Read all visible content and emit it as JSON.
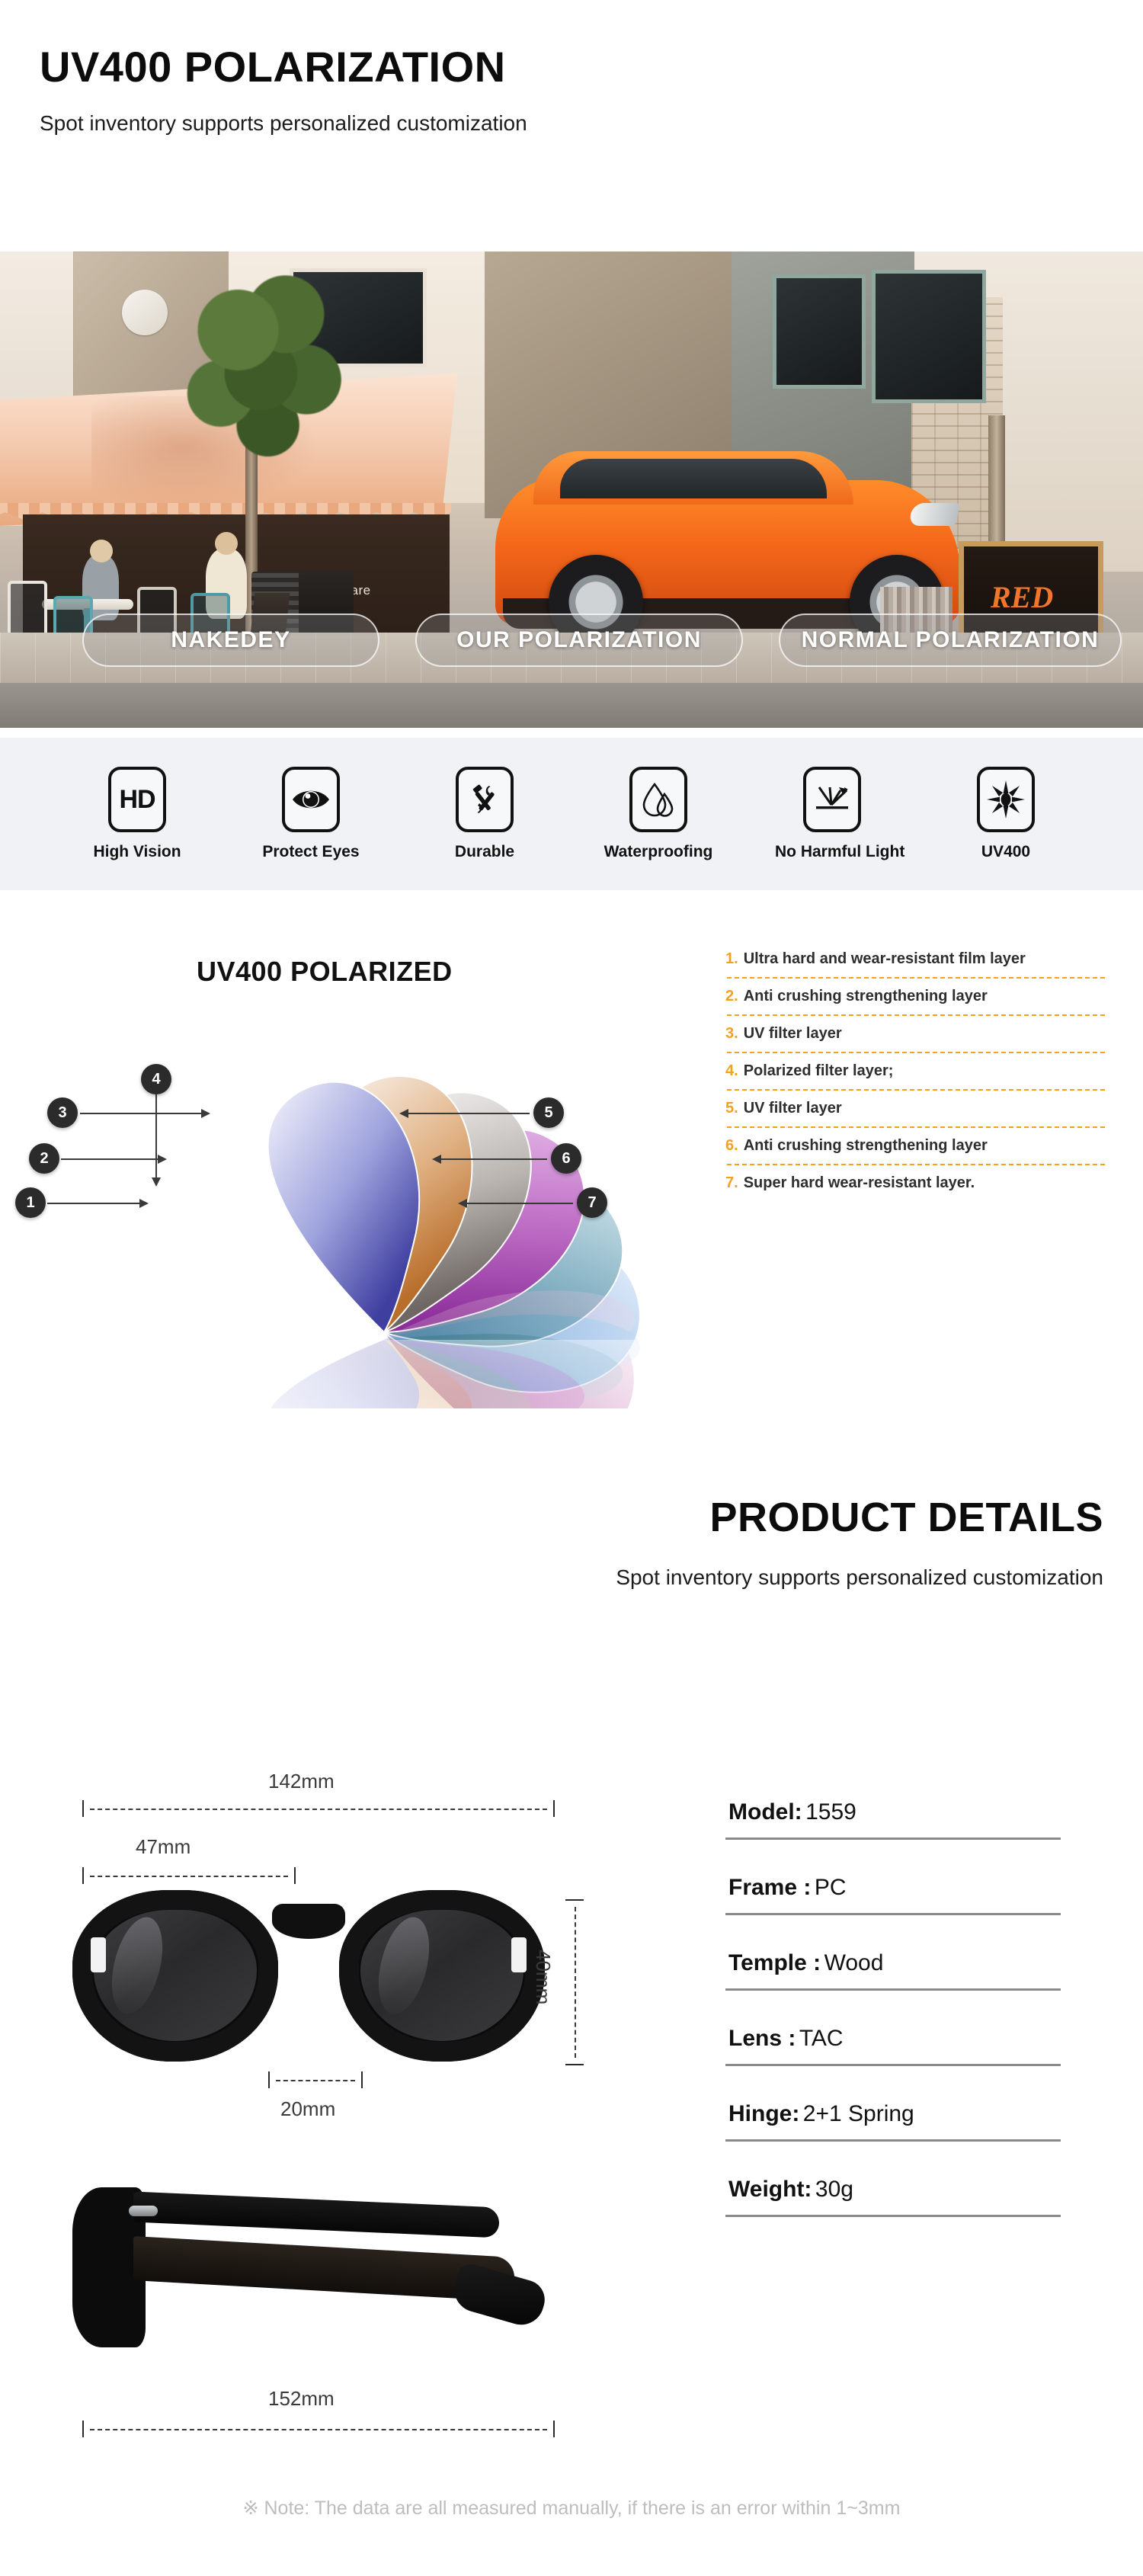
{
  "header": {
    "title": "UV400 POLARIZATION",
    "subtitle": "Spot inventory supports personalized customization"
  },
  "hero": {
    "shop_sign": "Chware",
    "shop_logo": "RED",
    "overlays": [
      {
        "label": "NAKEDEY"
      },
      {
        "label": "OUR POLARIZATION"
      },
      {
        "label": "NORMAL POLARIZATION"
      }
    ]
  },
  "features": [
    {
      "icon": "hd-icon",
      "glyph": "HD",
      "label": "High Vision"
    },
    {
      "icon": "eye-icon",
      "glyph": "",
      "label": "Protect Eyes"
    },
    {
      "icon": "tools-icon",
      "glyph": "",
      "label": "Durable"
    },
    {
      "icon": "water-drop-icon",
      "glyph": "",
      "label": "Waterproofing"
    },
    {
      "icon": "light-reflect-icon",
      "glyph": "",
      "label": "No Harmful Light"
    },
    {
      "icon": "sun-icon",
      "glyph": "",
      "label": "UV400"
    }
  ],
  "lens_section": {
    "title": "UV400 POLARIZED",
    "layers": [
      {
        "num": "1.",
        "text": "Ultra hard and wear-resistant film layer",
        "color": "#5a5fc0"
      },
      {
        "num": "2.",
        "text": "Anti crushing strengthening layer",
        "color": "#d08a4e"
      },
      {
        "num": "3.",
        "text": "UV filter layer",
        "color": "#8e8b88"
      },
      {
        "num": "4.",
        "text": "Polarized filter layer;",
        "color": "#a84bb0"
      },
      {
        "num": "5.",
        "text": "UV filter layer",
        "color": "#5a9fb5"
      },
      {
        "num": "6.",
        "text": "Anti crushing strengthening layer",
        "color": "#8fb4de"
      },
      {
        "num": "7.",
        "text": "Super hard wear-resistant layer.",
        "color": "#d9a8cb"
      }
    ],
    "callouts": [
      "1",
      "2",
      "3",
      "4",
      "5",
      "6",
      "7"
    ],
    "accent_color": "#f5a11e"
  },
  "product_details": {
    "title": "PRODUCT DETAILS",
    "subtitle": "Spot inventory supports personalized customization"
  },
  "specs": [
    {
      "key": "Model:",
      "value": "1559"
    },
    {
      "key": "Frame :",
      "value": "PC"
    },
    {
      "key": "Temple :",
      "value": "Wood"
    },
    {
      "key": "Lens :",
      "value": "TAC"
    },
    {
      "key": "Hinge:",
      "value": "2+1 Spring"
    },
    {
      "key": "Weight:",
      "value": "30g"
    }
  ],
  "dimensions": {
    "total_width": "142mm",
    "lens_width": "47mm",
    "lens_height": "40mm",
    "bridge_width": "20mm",
    "temple_length": "152mm"
  },
  "footer": {
    "note": "※ Note: The data are all measured manually, if there is an error within 1~3mm"
  }
}
